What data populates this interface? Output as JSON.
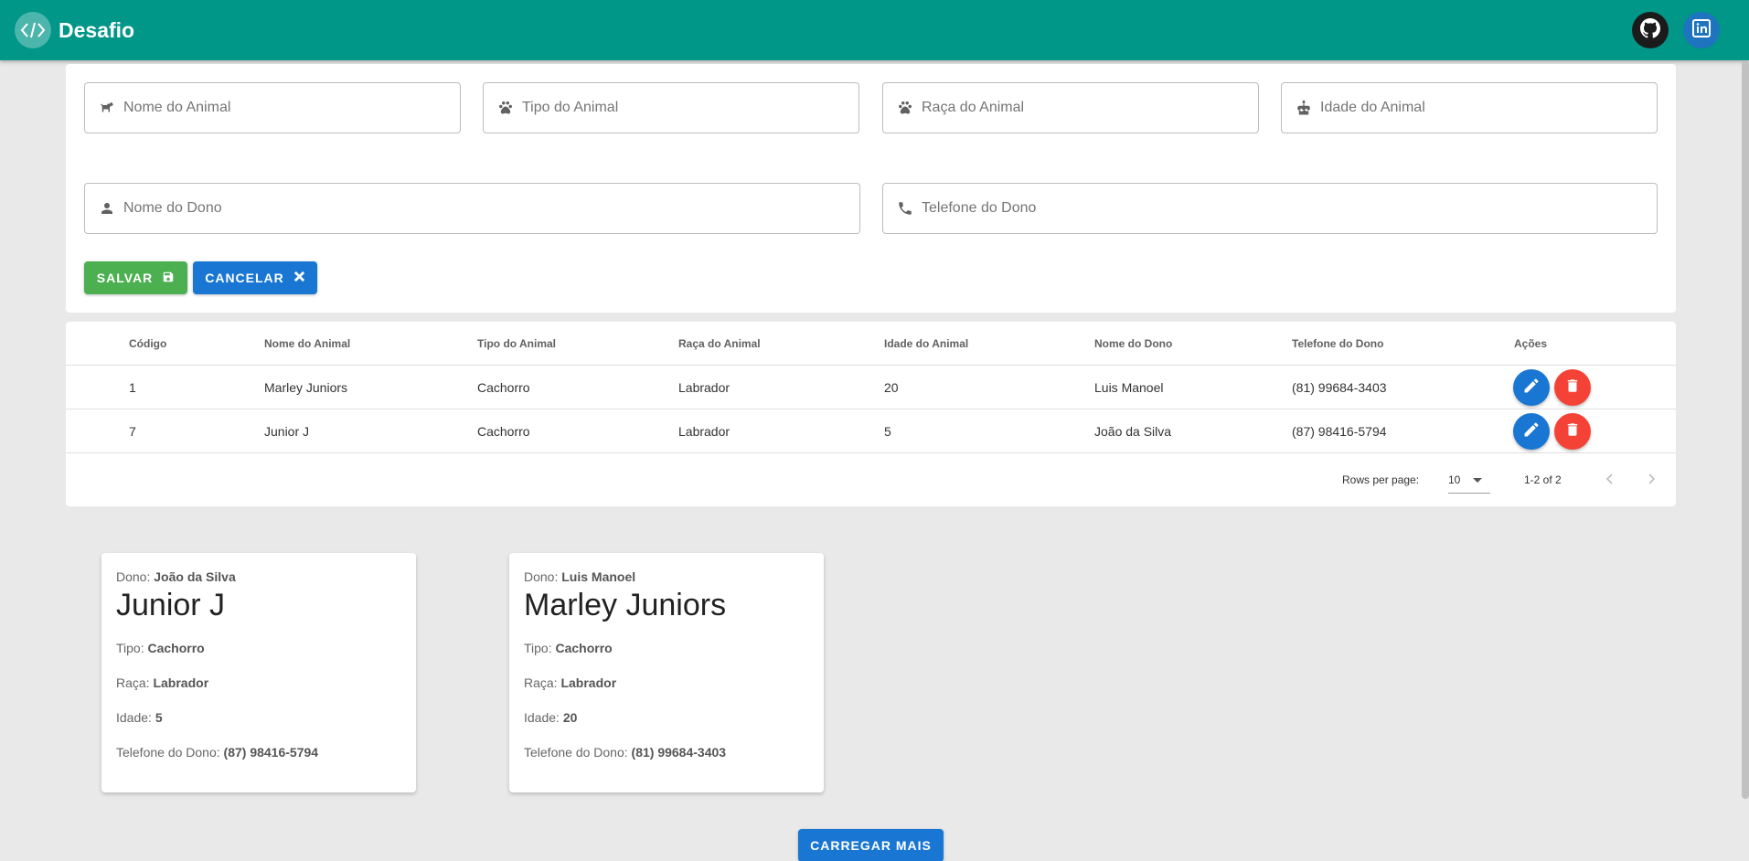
{
  "app": {
    "brand": "Desafio"
  },
  "header": {
    "github_icon": "github-icon",
    "linkedin_icon": "linkedin-icon"
  },
  "form": {
    "animal_name_placeholder": "Nome do Animal",
    "animal_type_placeholder": "Tipo do Animal",
    "animal_breed_placeholder": "Raça do Animal",
    "animal_age_placeholder": "Idade do Animal",
    "owner_name_placeholder": "Nome do Dono",
    "owner_phone_placeholder": "Telefone do Dono",
    "save_label": "SALVAR",
    "cancel_label": "CANCELAR"
  },
  "table": {
    "columns": [
      "Código",
      "Nome do Animal",
      "Tipo do Animal",
      "Raça do Animal",
      "Idade do Animal",
      "Nome do Dono",
      "Telefone do Dono",
      "Ações"
    ],
    "rows": [
      {
        "codigo": "1",
        "nome": "Marley Juniors",
        "tipo": "Cachorro",
        "raca": "Labrador",
        "idade": "20",
        "dono": "Luis Manoel",
        "telefone": "(81) 99684-3403"
      },
      {
        "codigo": "7",
        "nome": "Junior J",
        "tipo": "Cachorro",
        "raca": "Labrador",
        "idade": "5",
        "dono": "João da Silva",
        "telefone": "(87) 98416-5794"
      }
    ],
    "pagination": {
      "rows_per_page_label": "Rows per page:",
      "rows_per_page": "10",
      "range": "1-2 of 2"
    }
  },
  "cards": [
    {
      "owner_label": "Dono:",
      "owner": "João da Silva",
      "name": "Junior J",
      "type_label": "Tipo:",
      "type": "Cachorro",
      "breed_label": "Raça:",
      "breed": "Labrador",
      "age_label": "Idade:",
      "age": "5",
      "phone_label": "Telefone do Dono:",
      "phone": "(87) 98416-5794"
    },
    {
      "owner_label": "Dono:",
      "owner": "Luis Manoel",
      "name": "Marley Juniors",
      "type_label": "Tipo:",
      "type": "Cachorro",
      "breed_label": "Raça:",
      "breed": "Labrador",
      "age_label": "Idade:",
      "age": "20",
      "phone_label": "Telefone do Dono:",
      "phone": "(81) 99684-3403"
    }
  ],
  "load_more_label": "CARREGAR MAIS",
  "colors": {
    "primary": "#009688",
    "blue": "#1976d2",
    "green": "#4caf50",
    "red": "#f44336"
  }
}
